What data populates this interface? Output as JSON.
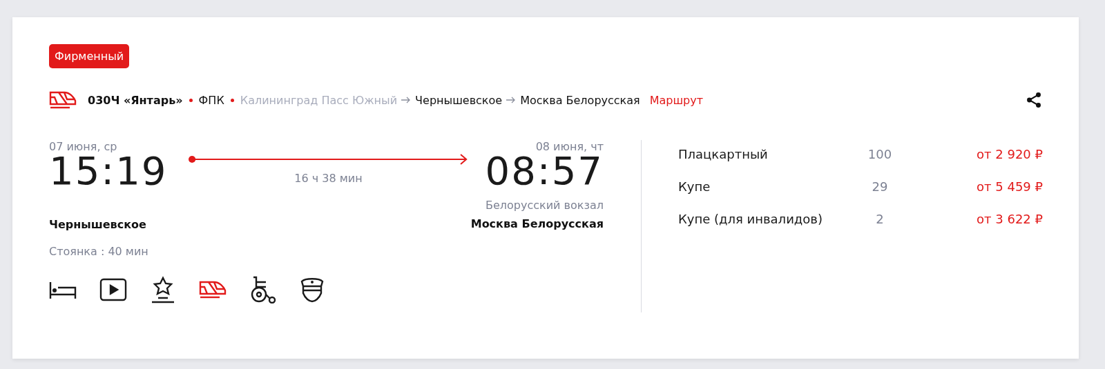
{
  "badge": "Фирменный",
  "train": {
    "number": "030Ч «Янтарь»",
    "carrier": "ФПК",
    "stops": [
      {
        "name": "Калининград Пасс Южный",
        "passed": true
      },
      {
        "name": "Чернышевское",
        "passed": false
      },
      {
        "name": "Москва Белорусская",
        "passed": false
      }
    ],
    "route_link": "Маршрут"
  },
  "departure": {
    "date": "07 июня, ср",
    "time": "15:19",
    "station": "Чернышевское",
    "stop": "Стоянка : 40 мин"
  },
  "duration": "16 ч 38 мин",
  "arrival": {
    "date": "08 июня, чт",
    "time": "08:57",
    "terminal": "Белорусский вокзал",
    "station": "Москва Белорусская"
  },
  "fares": [
    {
      "class": "Плацкартный",
      "seats": "100",
      "price": "от 2 920 ₽"
    },
    {
      "class": "Купе",
      "seats": "29",
      "price": "от 5 459 ₽"
    },
    {
      "class": "Купе (для инвалидов)",
      "seats": "2",
      "price": "от 3 622 ₽"
    }
  ]
}
